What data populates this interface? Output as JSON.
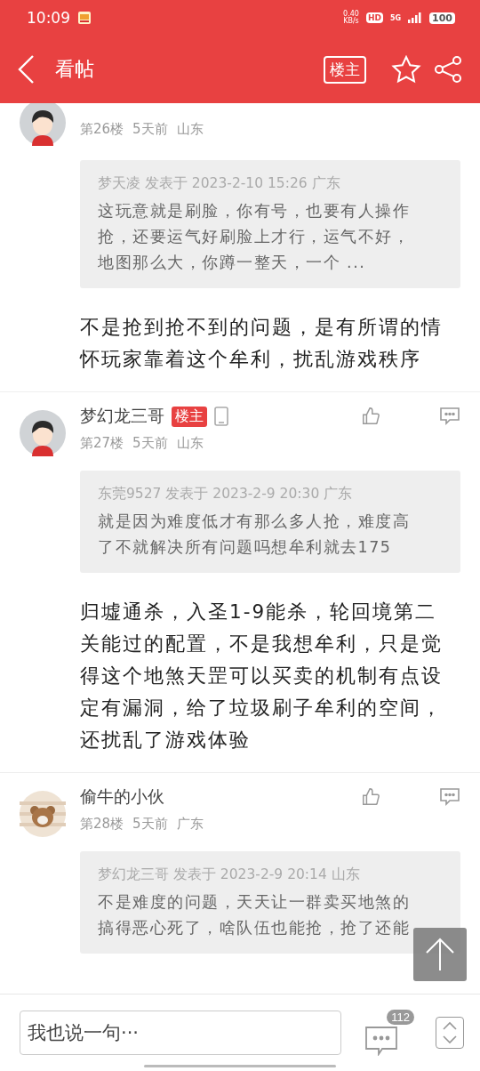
{
  "status_bar": {
    "time": "10:09",
    "speed": "0.40",
    "speed_unit": "KB/s",
    "hd": "HD",
    "network": "5G",
    "battery": "100"
  },
  "header": {
    "title": "看帖",
    "owner_filter": "楼主"
  },
  "posts": [
    {
      "floor": "第26楼",
      "time": "5天前",
      "region": "山东",
      "quote": {
        "meta": "梦天凌 发表于 2023-2-10 15:26 广东",
        "text": "这玩意就是刷脸，你有号，也要有人操作抢，还要运气好刷脸上才行，运气不好，地图那么大，你蹲一整天，一个 ..."
      },
      "text": "不是抢到抢不到的问题，是有所谓的情怀玩家靠着这个牟利，扰乱游戏秩序"
    },
    {
      "author": "梦幻龙三哥",
      "op": true,
      "op_label": "楼主",
      "mobile": true,
      "floor": "第27楼",
      "time": "5天前",
      "region": "山东",
      "quote": {
        "meta": "东莞9527 发表于 2023-2-9 20:30 广东",
        "text": "就是因为难度低才有那么多人抢，难度高了不就解决所有问题吗想牟利就去175"
      },
      "text": "归墟通杀，入圣1-9能杀，轮回境第二关能过的配置，不是我想牟利，只是觉得这个地煞天罡可以买卖的机制有点设定有漏洞，给了垃圾刷子牟利的空间，还扰乱了游戏体验"
    },
    {
      "author": "偷牛的小伙",
      "op": false,
      "mobile": false,
      "floor": "第28楼",
      "time": "5天前",
      "region": "广东",
      "quote": {
        "meta": "梦幻龙三哥 发表于 2023-2-9 20:14 山东",
        "text": "不是难度的问题，天天让一群卖买地煞的搞得恶心死了，啥队伍也能抢，抢了还能"
      }
    }
  ],
  "composer": {
    "placeholder": "我也说一句···",
    "comment_count": "112"
  }
}
